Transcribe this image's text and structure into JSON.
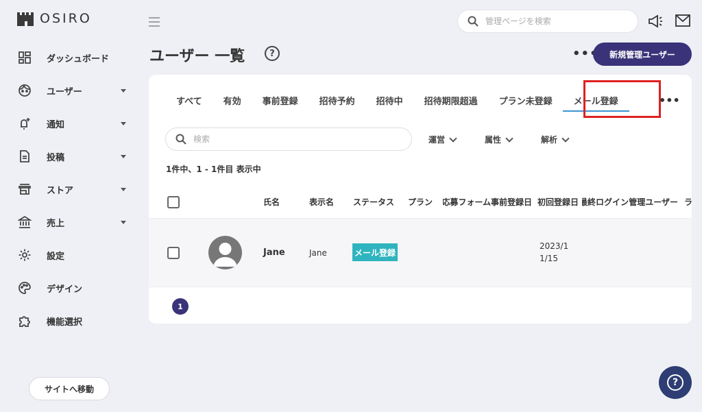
{
  "brand": {
    "name": "OSIRO"
  },
  "sidebar": {
    "items": [
      {
        "label": "ダッシュボード",
        "icon": "dashboard-icon",
        "has_caret": false
      },
      {
        "label": "ユーザー",
        "icon": "user-face-icon",
        "has_caret": true
      },
      {
        "label": "通知",
        "icon": "bell-plus-icon",
        "has_caret": true
      },
      {
        "label": "投稿",
        "icon": "document-icon",
        "has_caret": true
      },
      {
        "label": "ストア",
        "icon": "store-icon",
        "has_caret": true
      },
      {
        "label": "売上",
        "icon": "bank-icon",
        "has_caret": true
      },
      {
        "label": "設定",
        "icon": "gear-icon",
        "has_caret": false
      },
      {
        "label": "デザイン",
        "icon": "palette-icon",
        "has_caret": false
      },
      {
        "label": "機能選択",
        "icon": "puzzle-icon",
        "has_caret": false
      }
    ],
    "site_button": "サイトへ移動"
  },
  "header": {
    "search_placeholder": "管理ページを検索"
  },
  "page": {
    "title": "ユーザー 一覧",
    "new_admin_button": "新規管理ユーザー"
  },
  "tabs": [
    "すべて",
    "有効",
    "事前登録",
    "招待予約",
    "招待中",
    "招待期限超過",
    "プラン未登録",
    "メール登録"
  ],
  "active_tab": "メール登録",
  "filters": {
    "search_placeholder": "検索",
    "dropdowns": [
      "運営",
      "属性",
      "解析"
    ]
  },
  "result_count": "1件中、1 - 1件目 表示中",
  "table": {
    "columns": [
      "氏名",
      "表示名",
      "ステータス",
      "プラン",
      "応募フォーム",
      "事前登録日",
      "初回登録日",
      "最終ログイン",
      "管理ユーザー",
      "ラ"
    ],
    "rows": [
      {
        "name": "Jane",
        "display_name": "Jane",
        "status": "メール登録",
        "first_registered_line1": "2023/1",
        "first_registered_line2": "1/15"
      }
    ]
  },
  "pagination": {
    "current": "1"
  },
  "colors": {
    "accent": "#3a3379",
    "status_badge": "#2fb4bf",
    "tab_underline": "#3b93d3",
    "highlight_box": "#e02020"
  }
}
